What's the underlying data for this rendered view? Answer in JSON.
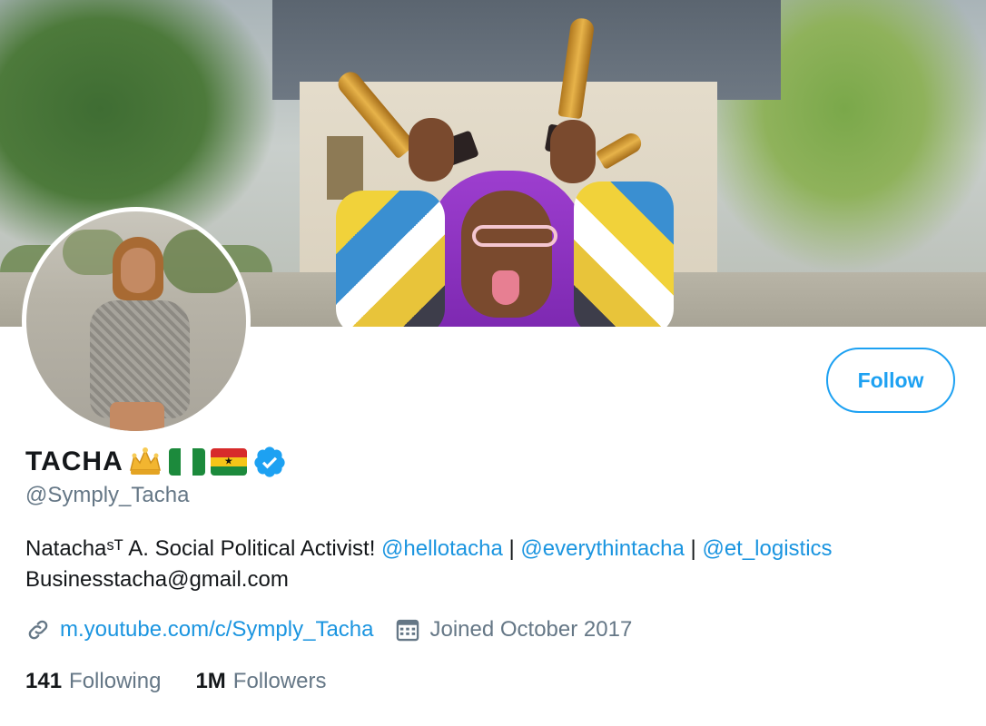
{
  "profile": {
    "display_name": "TACHA",
    "handle": "@Symply_Tacha",
    "verified": true,
    "emoji": [
      "crown-icon",
      "nigeria-flag-icon",
      "ghana-flag-icon"
    ],
    "bio": {
      "text": "Natachaˢᵀ A. Social Political Activist!",
      "mentions": [
        "@hellotacha",
        "@everythintacha",
        "@et_logistics"
      ],
      "separator": "|",
      "email": "Businesstacha@gmail.com"
    },
    "website": "m.youtube.com/c/Symply_Tacha",
    "joined": "Joined October 2017",
    "stats": {
      "following_count": "141",
      "following_label": "Following",
      "followers_count": "1M",
      "followers_label": "Followers"
    }
  },
  "actions": {
    "follow_label": "Follow"
  },
  "colors": {
    "accent": "#1da1f2",
    "link": "#1b95e0",
    "muted_text": "#657786",
    "primary_text": "#14171a",
    "verified": "#1da1f2"
  }
}
